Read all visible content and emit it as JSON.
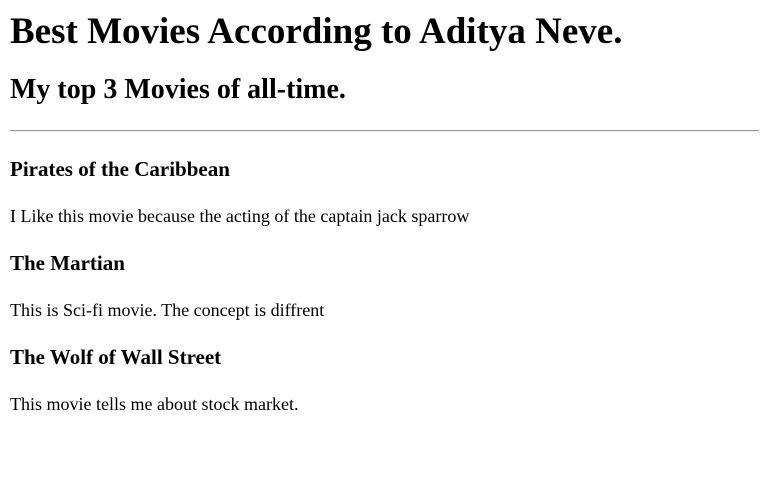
{
  "page": {
    "title": "Best Movies According to Aditya Neve.",
    "subtitle": "My top 3 Movies of all-time."
  },
  "movies": [
    {
      "title": "Pirates of the Caribbean",
      "description": "I Like this movie because the acting of the captain jack sparrow"
    },
    {
      "title": "The Martian",
      "description": "This is Sci-fi movie. The concept is diffrent"
    },
    {
      "title": "The Wolf of Wall Street",
      "description": "This movie tells me about stock market."
    }
  ]
}
